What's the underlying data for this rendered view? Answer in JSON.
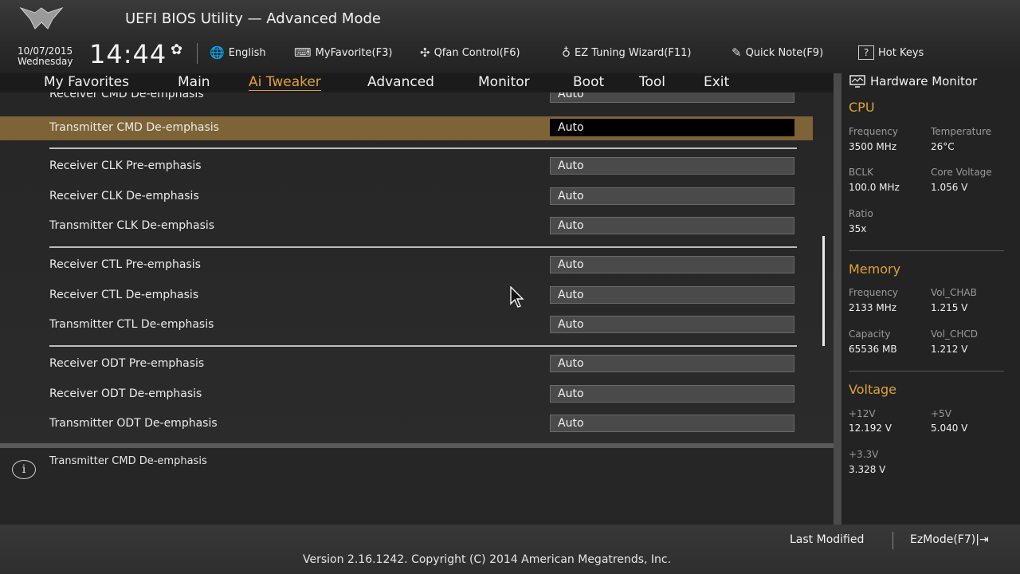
{
  "header": {
    "title": "UEFI BIOS Utility — Advanced Mode",
    "date": "10/07/2015",
    "weekday": "Wednesday",
    "time": "14:44",
    "toolbar": [
      {
        "name": "language-button",
        "icon": "globe-icon",
        "glyph": "🌐",
        "label": "English"
      },
      {
        "name": "myfavorite-button",
        "icon": "keyboard-icon",
        "glyph": "⌨",
        "label": "MyFavorite(F3)"
      },
      {
        "name": "qfan-control-button",
        "icon": "fan-icon",
        "glyph": "✣",
        "label": "Qfan Control(F6)"
      },
      {
        "name": "ez-tuning-wizard-button",
        "icon": "bulb-icon",
        "glyph": "♁",
        "label": "EZ Tuning Wizard(F11)"
      },
      {
        "name": "quick-note-button",
        "icon": "note-icon",
        "glyph": "✎",
        "label": "Quick Note(F9)"
      },
      {
        "name": "hot-keys-button",
        "icon": "help-box-icon",
        "glyph": "?",
        "label": "Hot Keys"
      }
    ]
  },
  "tabs": [
    "My Favorites",
    "Main",
    "Ai Tweaker",
    "Advanced",
    "Monitor",
    "Boot",
    "Tool",
    "Exit"
  ],
  "active_tab": "Ai Tweaker",
  "settings": {
    "partial_top": {
      "label": "Receiver CMD De-emphasis",
      "value": "Auto"
    },
    "selected": {
      "label": "Transmitter CMD De-emphasis",
      "value": "Auto"
    },
    "clk": [
      {
        "label": "Receiver CLK Pre-emphasis",
        "value": "Auto"
      },
      {
        "label": "Receiver CLK De-emphasis",
        "value": "Auto"
      },
      {
        "label": "Transmitter CLK De-emphasis",
        "value": "Auto"
      }
    ],
    "ctl": [
      {
        "label": "Receiver CTL Pre-emphasis",
        "value": "Auto"
      },
      {
        "label": "Receiver CTL De-emphasis",
        "value": "Auto"
      },
      {
        "label": "Transmitter CTL De-emphasis",
        "value": "Auto"
      }
    ],
    "odt": [
      {
        "label": "Receiver ODT Pre-emphasis",
        "value": "Auto"
      },
      {
        "label": "Receiver ODT De-emphasis",
        "value": "Auto"
      },
      {
        "label": "Transmitter ODT De-emphasis",
        "value": "Auto"
      }
    ]
  },
  "help": {
    "text": "Transmitter CMD De-emphasis"
  },
  "hardware_monitor": {
    "title": "Hardware Monitor",
    "cpu": {
      "heading": "CPU",
      "frequency_label": "Frequency",
      "frequency": "3500 MHz",
      "temperature_label": "Temperature",
      "temperature": "26°C",
      "bclk_label": "BCLK",
      "bclk": "100.0 MHz",
      "core_voltage_label": "Core Voltage",
      "core_voltage": "1.056 V",
      "ratio_label": "Ratio",
      "ratio": "35x"
    },
    "memory": {
      "heading": "Memory",
      "frequency_label": "Frequency",
      "frequency": "2133 MHz",
      "vol_chab_label": "Vol_CHAB",
      "vol_chab": "1.215 V",
      "capacity_label": "Capacity",
      "capacity": "65536 MB",
      "vol_chcd_label": "Vol_CHCD",
      "vol_chcd": "1.212 V"
    },
    "voltage": {
      "heading": "Voltage",
      "v12_label": "+12V",
      "v12": "12.192 V",
      "v5_label": "+5V",
      "v5": "5.040 V",
      "v33_label": "+3.3V",
      "v33": "3.328 V"
    }
  },
  "footer": {
    "last_modified": "Last Modified",
    "ezmode": "EzMode(F7)|⇥",
    "version": "Version 2.16.1242. Copyright (C) 2014 American Megatrends, Inc."
  },
  "colors": {
    "accent": "#e0a235",
    "selected_row": "#7d6335"
  }
}
